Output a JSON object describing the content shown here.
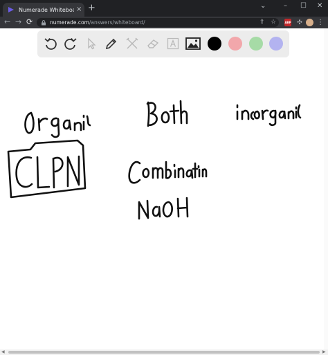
{
  "browser": {
    "tab_title": "Numerade Whiteboard",
    "tab_close": "×",
    "new_tab": "+",
    "url_host": "numerade.com",
    "url_path": "/answers/whiteboard/",
    "minimize": "–",
    "maximize": "☐",
    "close": "✕",
    "back": "←",
    "forward": "→",
    "reload": "⟳",
    "extension_label": "ABP",
    "menu": "⋮"
  },
  "whiteboard": {
    "tools": [
      "undo-icon",
      "redo-icon",
      "select-icon",
      "pen-icon",
      "tools-icon",
      "eraser-icon",
      "text-icon",
      "image-icon"
    ],
    "colors": [
      "#000000",
      "#f2a7ab",
      "#a6dba6",
      "#b3b3f0"
    ],
    "handwritten_text": [
      "organic",
      "Both",
      "inorganic",
      "CLPN",
      "Combination",
      "NaOH"
    ]
  }
}
